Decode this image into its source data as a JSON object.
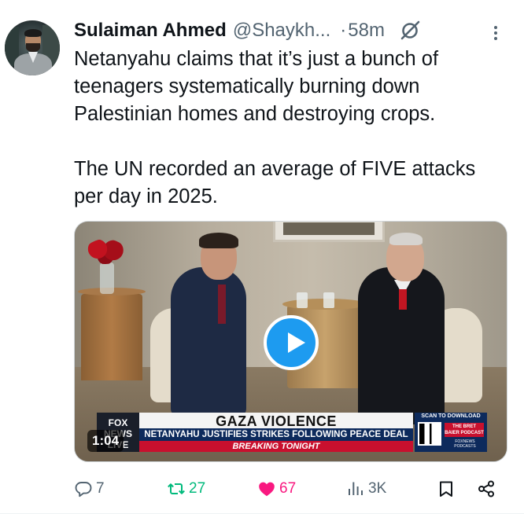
{
  "tweet": {
    "author": {
      "display_name": "Sulaiman Ahmed",
      "handle": "@Shaykh...",
      "time": "58m",
      "separator": "·"
    },
    "text_lines": [
      "Netanyahu claims that it’s just a bunch of",
      "teenagers systematically burning down",
      "Palestinian homes and destroying crops.",
      "The UN recorded an average of FIVE attacks",
      "per day in 2025."
    ],
    "media": {
      "type": "video",
      "duration": "1:04",
      "chyron": {
        "network": "FOX NEWS LIVE",
        "headline": "GAZA VIOLENCE",
        "subhead": "NETANYAHU JUSTIFIES STRIKES FOLLOWING PEACE DEAL",
        "banner": "BREAKING TONIGHT",
        "qr_label": "SCAN TO DOWNLOAD",
        "podcast": "THE BRET BAIER PODCAST",
        "podcast_sub": "FOXNEWS PODCASTS"
      }
    },
    "actions": {
      "replies": "7",
      "reposts": "27",
      "likes": "67",
      "views": "3K"
    },
    "colors": {
      "repost_active": "#00ba7c",
      "like_active": "#f91880",
      "muted": "#536471",
      "play_button": "#1d9bf0"
    },
    "icons": [
      "grok-icon",
      "more-icon",
      "play-icon",
      "reply-icon",
      "repost-icon",
      "heart-icon",
      "views-icon",
      "bookmark-icon",
      "share-icon"
    ]
  }
}
